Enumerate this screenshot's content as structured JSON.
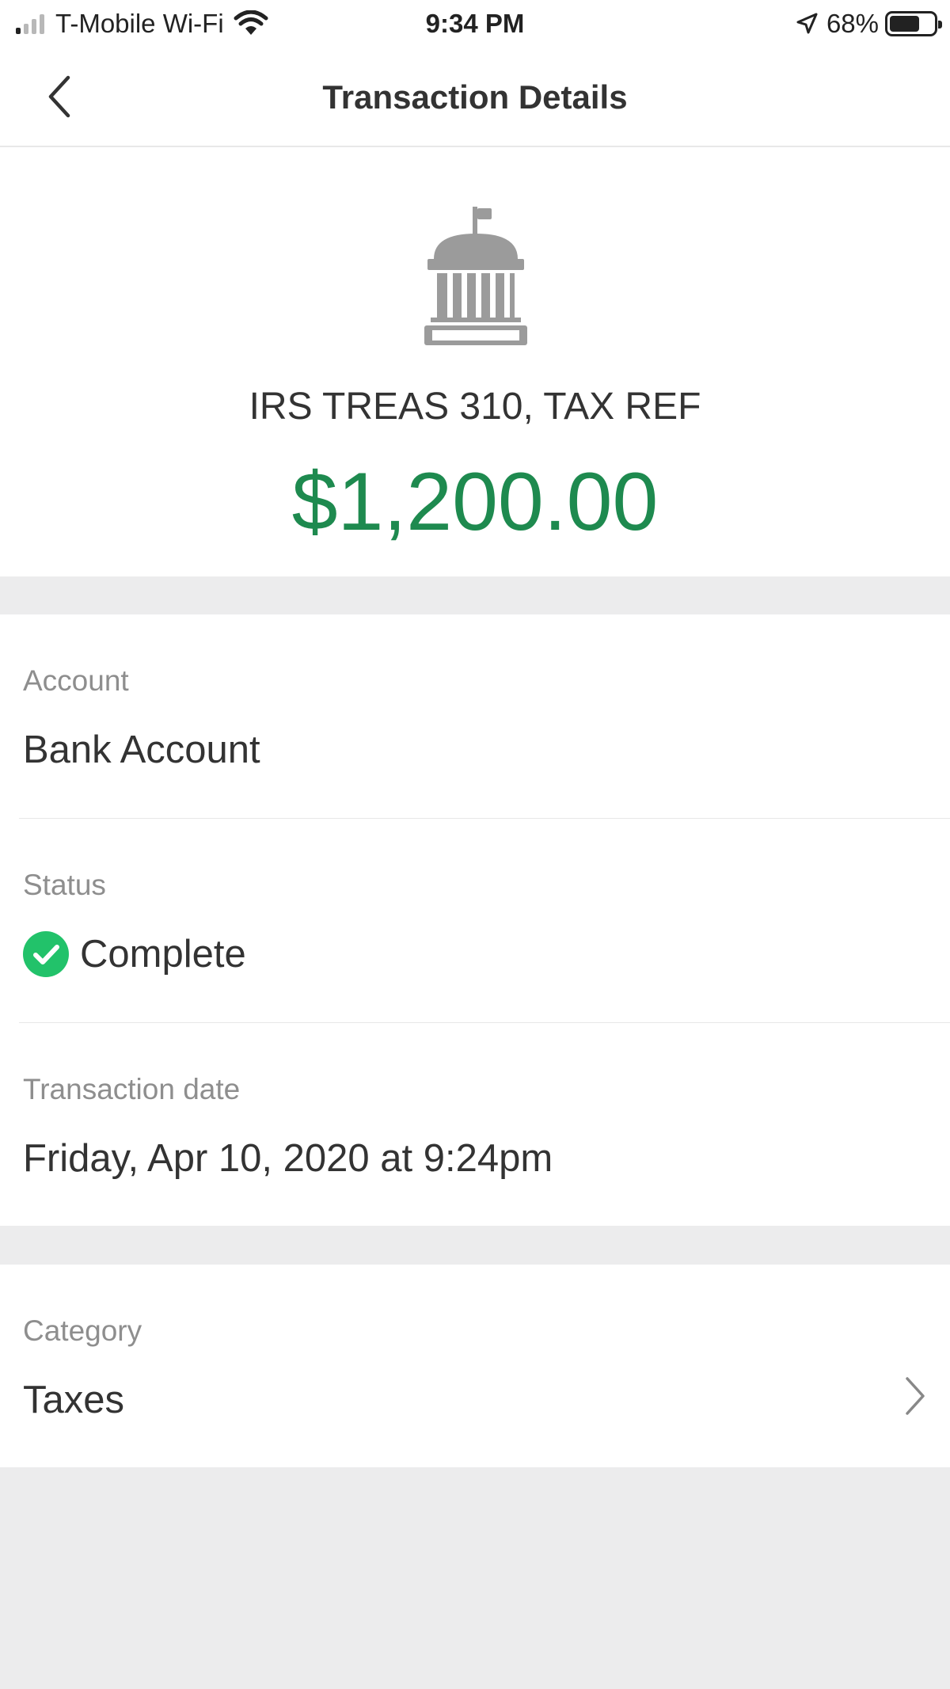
{
  "status_bar": {
    "carrier": "T-Mobile Wi-Fi",
    "time": "9:34 PM",
    "battery_percent": "68%",
    "battery_level": 0.68,
    "signal_bars_active": 1,
    "icons": [
      "wifi-icon",
      "location-arrow-icon",
      "battery-icon"
    ]
  },
  "nav": {
    "title": "Transaction Details",
    "back_icon": "chevron-left-icon"
  },
  "transaction": {
    "icon": "bank-building-icon",
    "merchant": "IRS TREAS 310, TAX REF",
    "amount": "$1,200.00",
    "amount_color": "#1e8a4f"
  },
  "details": [
    {
      "label": "Account",
      "value": "Bank Account"
    },
    {
      "label": "Status",
      "value": "Complete",
      "status_color": "#22c26a"
    },
    {
      "label": "Transaction date",
      "value": "Friday, Apr 10, 2020 at 9:24pm"
    }
  ],
  "category": {
    "label": "Category",
    "value": "Taxes",
    "icon": "chevron-right-icon"
  }
}
